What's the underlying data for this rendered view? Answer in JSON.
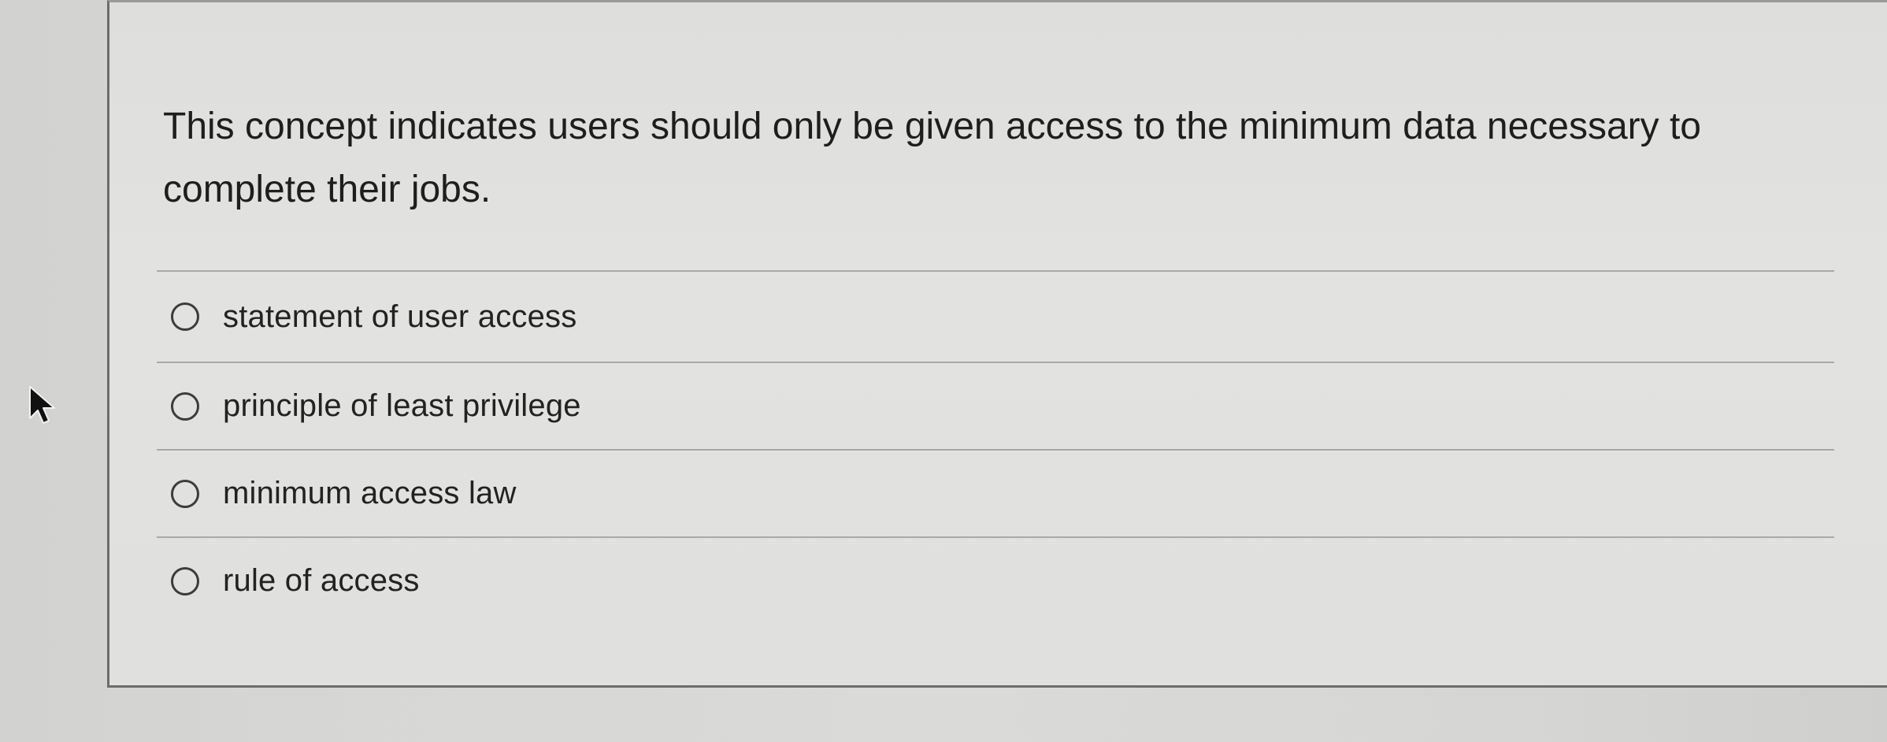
{
  "question": {
    "text": "This concept indicates users should only be given access to the minimum data necessary to complete their jobs."
  },
  "options": [
    {
      "label": "statement of user access",
      "selected": false
    },
    {
      "label": "principle of least privilege",
      "selected": false
    },
    {
      "label": "minimum access law",
      "selected": false
    },
    {
      "label": "rule of access",
      "selected": false
    }
  ],
  "icons": {
    "option_marker": "radio-button-icon",
    "pointer": "mouse-pointer-icon"
  }
}
